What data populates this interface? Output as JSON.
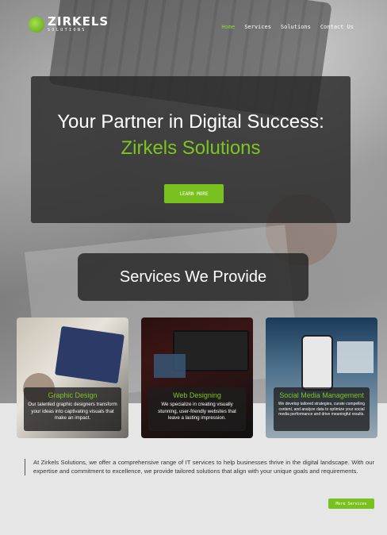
{
  "nav": {
    "logo_name": "ZIRKELS",
    "logo_sub": "SOLUTIONS",
    "items": [
      {
        "label": "Home"
      },
      {
        "label": "Services"
      },
      {
        "label": "Solutions"
      },
      {
        "label": "Contact Us"
      }
    ],
    "active_color": "#8bd43a"
  },
  "hero": {
    "title": "Your Partner in Digital Success:",
    "subtitle": "Zirkels Solutions",
    "button": "LEARN MORE"
  },
  "services": {
    "heading": "Services We Provide",
    "cards": [
      {
        "title": "Graphic Design",
        "desc": "Our talented graphic designers transform your ideas into captivating visuals that make an impact."
      },
      {
        "title": "Web Designing",
        "desc": "We specialize in creating visually stunning, user-friendly websites that leave a lasting impression."
      },
      {
        "title": "Social Media Management",
        "desc": "We develop tailored strategies, curate compelling content, and analyze data to optimize your social media performance and drive meaningful results."
      }
    ]
  },
  "intro": {
    "text": "At Zirkels Solutions, we offer a comprehensive range of IT services to help businesses thrive in the digital landscape. With our expertise and commitment to excellence, we provide tailored solutions that align with your unique goals and requirements.",
    "button": "More Services"
  },
  "colors": {
    "accent": "#7cc521",
    "panel": "#282828"
  }
}
